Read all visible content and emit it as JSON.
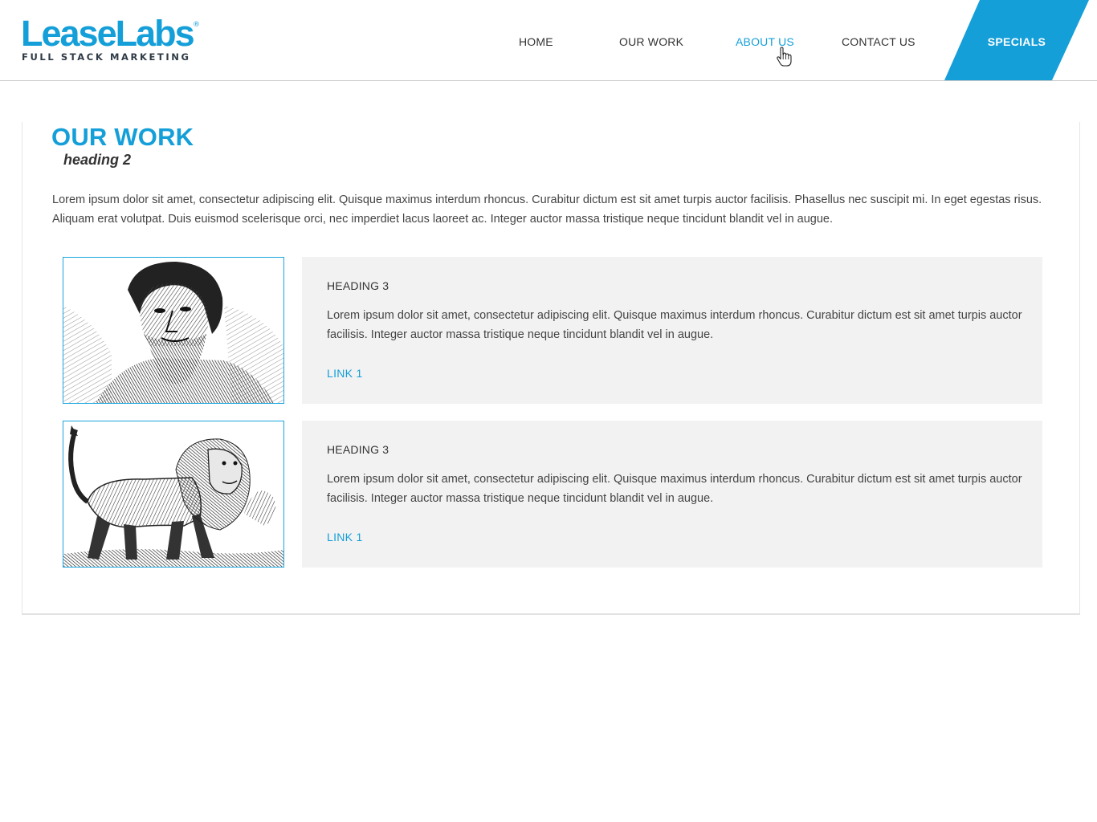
{
  "header": {
    "logo_main": "LeaseLabs",
    "logo_reg": "®",
    "logo_tagline": "FULL STACK MARKETING",
    "nav": [
      {
        "label": "HOME"
      },
      {
        "label": "OUR WORK"
      },
      {
        "label": "ABOUT US",
        "active": true
      },
      {
        "label": "CONTACT US"
      }
    ],
    "specials_label": "SPECIALS"
  },
  "main": {
    "title": "OUR WORK",
    "subtitle": "heading 2",
    "intro": "Lorem ipsum dolor sit amet, consectetur adipiscing elit. Quisque maximus interdum rhoncus. Curabitur dictum est sit amet turpis auctor facilisis. Phasellus nec suscipit mi. In eget egestas risus. Aliquam erat volutpat. Duis euismod scelerisque orci, nec imperdiet lacus laoreet ac. Integer auctor massa tristique neque tincidunt blandit vel in augue.",
    "items": [
      {
        "image": "engraved-portrait-bearded-man",
        "heading": "HEADING 3",
        "text": "Lorem ipsum dolor sit amet, consectetur adipiscing elit. Quisque maximus interdum rhoncus. Curabitur dictum est sit amet turpis auctor facilisis. Integer auctor massa tristique neque tincidunt blandit vel in augue.",
        "link": "LINK 1"
      },
      {
        "image": "engraved-manticore-lion-creature",
        "heading": "HEADING 3",
        "text": "Lorem ipsum dolor sit amet, consectetur adipiscing elit. Quisque maximus interdum rhoncus. Curabitur dictum est sit amet turpis auctor facilisis. Integer auctor massa tristique neque tincidunt blandit vel in augue.",
        "link": "LINK 1"
      }
    ]
  },
  "colors": {
    "accent": "#159fd9",
    "card_bg": "#f2f2f2",
    "text": "#333333"
  },
  "icons": [
    "hand-pointer-cursor-icon"
  ]
}
